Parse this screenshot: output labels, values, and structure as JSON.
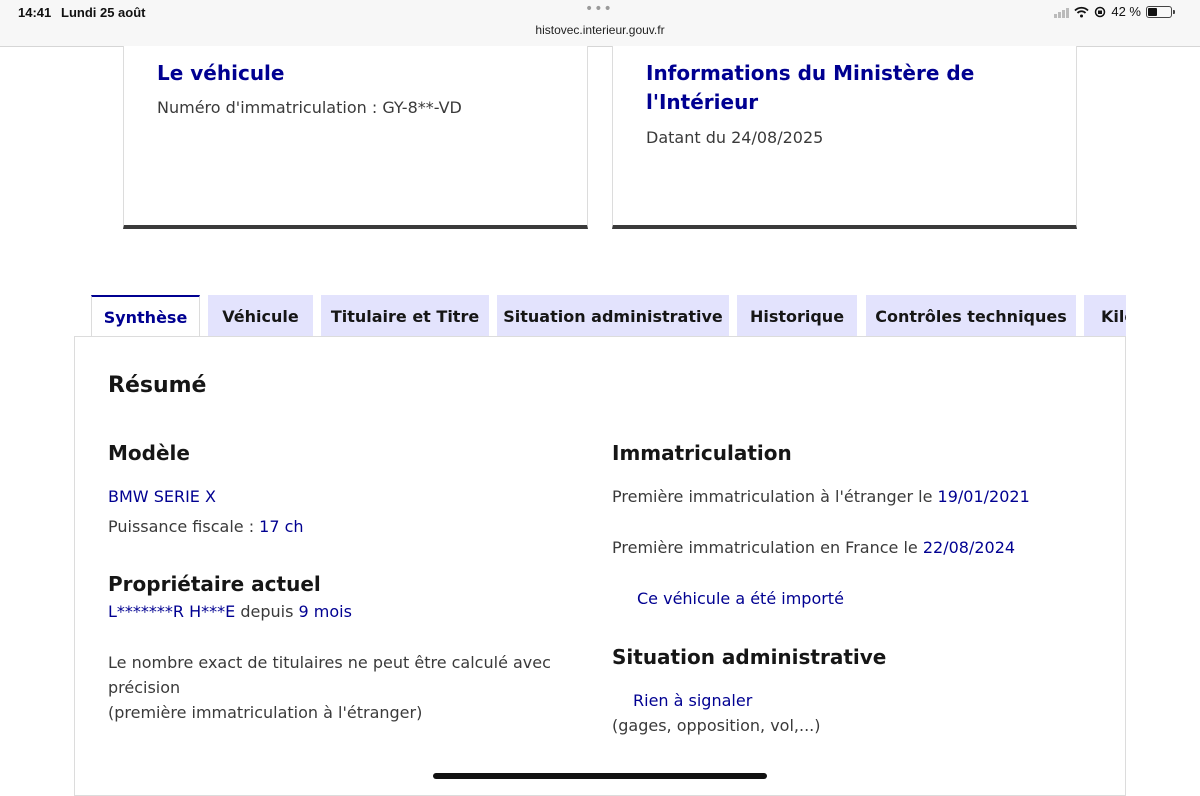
{
  "status_bar": {
    "time": "14:41",
    "date": "Lundi 25 août",
    "url": "histovec.interieur.gouv.fr",
    "battery": "42 %",
    "battery_level": 0.42
  },
  "cards": {
    "vehicle": {
      "title": "Le véhicule",
      "plate_label": "Numéro d'immatriculation : ",
      "plate": "GY-8**-VD"
    },
    "ministry": {
      "title_line1": "Informations du Ministère de",
      "title_line2": "l'Intérieur",
      "date_label": "Datant du ",
      "date": "24/08/2025"
    }
  },
  "tabs": [
    {
      "label": "Synthèse",
      "active": true
    },
    {
      "label": "Véhicule"
    },
    {
      "label": "Titulaire et Titre"
    },
    {
      "label": "Situation administrative"
    },
    {
      "label": "Historique"
    },
    {
      "label": "Contrôles techniques"
    },
    {
      "label": "Kilométrage"
    }
  ],
  "summary": {
    "title": "Résumé",
    "model": {
      "heading": "Modèle",
      "name": "BMW SERIE X",
      "power_label": "Puissance fiscale : ",
      "power": "17 ch"
    },
    "owner": {
      "heading": "Propriétaire actuel",
      "name": "L*******R H***E",
      "since_label": " depuis ",
      "since": "9 mois",
      "note_line1": "Le nombre exact de titulaires ne peut être calculé avec",
      "note_line2": "précision",
      "note_line3": "(première immatriculation à l'étranger)"
    },
    "registration": {
      "heading": "Immatriculation",
      "foreign_label": "Première immatriculation à l'étranger le ",
      "foreign_date": "19/01/2021",
      "france_label": "Première immatriculation en France le ",
      "france_date": "22/08/2024",
      "imported": "Ce véhicule a été importé"
    },
    "admin": {
      "heading": "Situation administrative",
      "status": "Rien à signaler",
      "detail": "(gages, opposition, vol,...)"
    }
  }
}
